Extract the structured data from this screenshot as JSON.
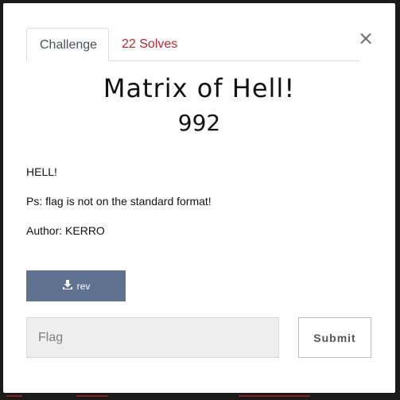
{
  "tabs": [
    {
      "label": "Challenge",
      "active": true
    },
    {
      "label": "22 Solves",
      "active": false
    }
  ],
  "close_icon": "×",
  "challenge": {
    "name": "Matrix of Hell!",
    "points": "992",
    "description": [
      "HELL!",
      "Ps: flag is not on the standard format!",
      "Author: KERRO"
    ]
  },
  "files": [
    {
      "label": "rev",
      "icon": "download-icon"
    }
  ],
  "flag_input": {
    "placeholder": "Flag",
    "value": ""
  },
  "submit_label": "Submit",
  "colors": {
    "accent_red": "#c0252a",
    "download_button": "#5f7391",
    "input_background": "#eeeeee"
  }
}
